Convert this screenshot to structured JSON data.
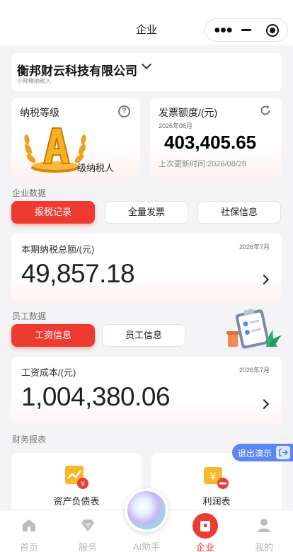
{
  "topbar": {
    "title": "企业",
    "capsule_more_icon": "more-dots-icon",
    "capsule_minimize_icon": "minimize-icon",
    "capsule_close_icon": "target-close-icon"
  },
  "company": {
    "name": "衡邦财云科技有限公司",
    "type": "小规模纳税人"
  },
  "tax_grade": {
    "label": "纳税等级",
    "grade": "A",
    "grade_text": "级纳税人"
  },
  "invoice": {
    "label": "发票额度/(元)",
    "month": "2026年08月",
    "amount": "403,405.65",
    "updated": "上次更新时间:2026/08/28"
  },
  "company_data": {
    "title": "企业数据",
    "tabs": [
      {
        "label": "报税记录",
        "active": true
      },
      {
        "label": "全量发票",
        "active": false
      },
      {
        "label": "社保信息",
        "active": false
      }
    ],
    "card": {
      "label": "本期纳税总额/(元)",
      "month": "2026年7月",
      "value": "49,857.18"
    }
  },
  "employee_data": {
    "title": "员工数据",
    "tabs": [
      {
        "label": "工资信息",
        "active": true
      },
      {
        "label": "员工信息",
        "active": false
      }
    ],
    "card": {
      "label": "工资成本/(元)",
      "month": "2026年7月",
      "value": "1,004,380.06"
    }
  },
  "finance": {
    "title": "财务报表",
    "items": [
      {
        "label": "资产负债表",
        "icon": "balance-sheet-icon"
      },
      {
        "label": "利润表",
        "icon": "profit-statement-icon"
      }
    ]
  },
  "exit_demo": {
    "label": "退出演示"
  },
  "tabbar": {
    "items": [
      {
        "label": "首页",
        "icon": "home-icon",
        "active": false
      },
      {
        "label": "服务",
        "icon": "diamond-icon",
        "active": false
      },
      {
        "label": "AI助手",
        "icon": "ai-orb-icon",
        "active": false
      },
      {
        "label": "企业",
        "icon": "enterprise-icon",
        "active": true
      },
      {
        "label": "我的",
        "icon": "user-icon",
        "active": false
      }
    ]
  },
  "colors": {
    "accent": "#ee3b32",
    "demo": "#5c87f2",
    "gold": "#f5a623"
  }
}
